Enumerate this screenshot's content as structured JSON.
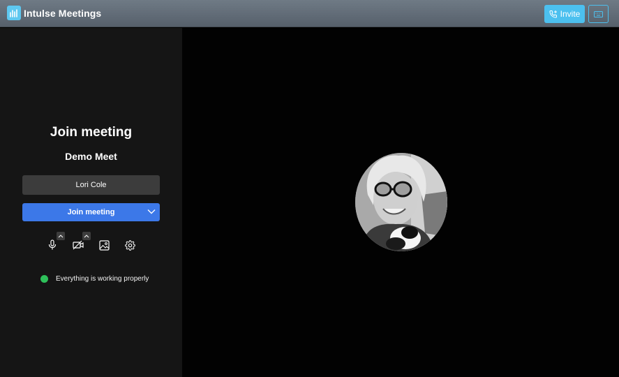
{
  "app": {
    "name": "Intulse Meetings"
  },
  "header": {
    "invite_label": "Invite",
    "invite_icon": "phone-plus-icon",
    "keyboard_icon": "keyboard-icon",
    "accent": "#4cc0ef"
  },
  "prejoin": {
    "title": "Join meeting",
    "meeting_name": "Demo Meet",
    "name_value": "Lori Cole",
    "join_label": "Join meeting",
    "join_color": "#3c78e8",
    "controls": [
      "microphone-icon",
      "video-off-icon",
      "background-image-icon",
      "settings-icon"
    ],
    "status_text": "Everything is working properly",
    "status_color": "#2ec05a"
  }
}
